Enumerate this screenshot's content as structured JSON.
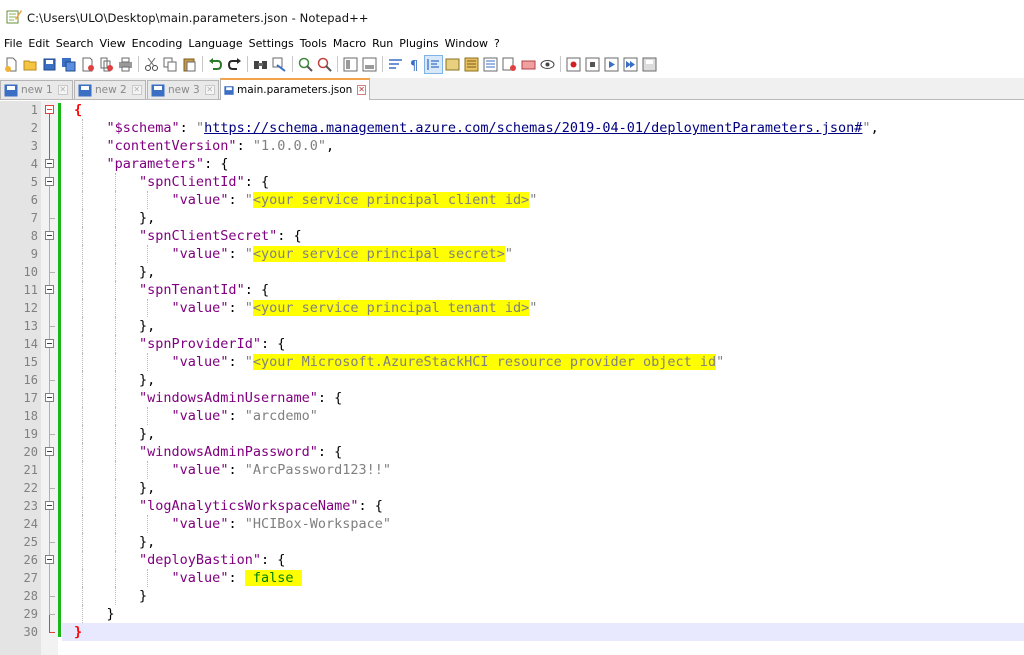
{
  "window": {
    "title": "C:\\Users\\ULO\\Desktop\\main.parameters.json - Notepad++"
  },
  "menu": [
    "File",
    "Edit",
    "Search",
    "View",
    "Encoding",
    "Language",
    "Settings",
    "Tools",
    "Macro",
    "Run",
    "Plugins",
    "Window",
    "?"
  ],
  "toolbar": {
    "icons": [
      "new-file-icon",
      "open-file-icon",
      "save-icon",
      "save-all-icon",
      "close-icon",
      "close-all-icon",
      "print-icon",
      "cut-icon",
      "copy-icon",
      "paste-icon",
      "undo-icon",
      "redo-icon",
      "find-icon",
      "replace-icon",
      "zoom-in-icon",
      "zoom-out-icon",
      "sync-vertical-icon",
      "sync-horizontal-icon",
      "word-wrap-icon",
      "show-all-chars-icon",
      "indent-guide-icon",
      "udl-icon",
      "doc-map-icon",
      "function-list-icon",
      "folder-workspace-icon",
      "monitoring-icon",
      "record-macro-icon",
      "stop-macro-icon",
      "play-macro-icon",
      "run-macro-multiple-icon",
      "save-macro-icon"
    ]
  },
  "tabs": [
    {
      "label": "new 1",
      "active": false
    },
    {
      "label": "new 2",
      "active": false
    },
    {
      "label": "new 3",
      "active": false
    },
    {
      "label": "main.parameters.json",
      "active": true
    }
  ],
  "editor": {
    "current_line": 30,
    "lines": [
      {
        "n": "1",
        "indent": 0,
        "parts": [
          {
            "t": "{",
            "c": "brace-hl"
          }
        ]
      },
      {
        "n": "2",
        "indent": 1,
        "parts": [
          {
            "t": "\"$schema\"",
            "c": "k"
          },
          {
            "t": ": ",
            "c": "p"
          },
          {
            "t": "\"",
            "c": "s"
          },
          {
            "t": "https://schema.management.azure.com/schemas/2019-04-01/deploymentParameters.json#",
            "c": "u"
          },
          {
            "t": "\"",
            "c": "s"
          },
          {
            "t": ",",
            "c": "p"
          }
        ]
      },
      {
        "n": "3",
        "indent": 1,
        "parts": [
          {
            "t": "\"contentVersion\"",
            "c": "k"
          },
          {
            "t": ": ",
            "c": "p"
          },
          {
            "t": "\"1.0.0.0\"",
            "c": "s"
          },
          {
            "t": ",",
            "c": "p"
          }
        ]
      },
      {
        "n": "4",
        "indent": 1,
        "parts": [
          {
            "t": "\"parameters\"",
            "c": "k"
          },
          {
            "t": ": {",
            "c": "p"
          }
        ]
      },
      {
        "n": "5",
        "indent": 2,
        "parts": [
          {
            "t": "\"spnClientId\"",
            "c": "k"
          },
          {
            "t": ": {",
            "c": "p"
          }
        ]
      },
      {
        "n": "6",
        "indent": 3,
        "parts": [
          {
            "t": "\"value\"",
            "c": "k"
          },
          {
            "t": ": ",
            "c": "p"
          },
          {
            "t": "\"",
            "c": "s"
          },
          {
            "t": "<your service principal client id>",
            "c": "s hl"
          },
          {
            "t": "\"",
            "c": "s"
          }
        ]
      },
      {
        "n": "7",
        "indent": 2,
        "parts": [
          {
            "t": "},",
            "c": "p"
          }
        ]
      },
      {
        "n": "8",
        "indent": 2,
        "parts": [
          {
            "t": "\"spnClientSecret\"",
            "c": "k"
          },
          {
            "t": ": {",
            "c": "p"
          }
        ]
      },
      {
        "n": "9",
        "indent": 3,
        "parts": [
          {
            "t": "\"value\"",
            "c": "k"
          },
          {
            "t": ": ",
            "c": "p"
          },
          {
            "t": "\"",
            "c": "s"
          },
          {
            "t": "<your service principal secret>",
            "c": "s hl"
          },
          {
            "t": "\"",
            "c": "s"
          }
        ]
      },
      {
        "n": "10",
        "indent": 2,
        "parts": [
          {
            "t": "},",
            "c": "p"
          }
        ]
      },
      {
        "n": "11",
        "indent": 2,
        "parts": [
          {
            "t": "\"spnTenantId\"",
            "c": "k"
          },
          {
            "t": ": {",
            "c": "p"
          }
        ]
      },
      {
        "n": "12",
        "indent": 3,
        "parts": [
          {
            "t": "\"value\"",
            "c": "k"
          },
          {
            "t": ": ",
            "c": "p"
          },
          {
            "t": "\"",
            "c": "s"
          },
          {
            "t": "<your service principal tenant id>",
            "c": "s hl"
          },
          {
            "t": "\"",
            "c": "s"
          }
        ]
      },
      {
        "n": "13",
        "indent": 2,
        "parts": [
          {
            "t": "},",
            "c": "p"
          }
        ]
      },
      {
        "n": "14",
        "indent": 2,
        "parts": [
          {
            "t": "\"spnProviderId\"",
            "c": "k"
          },
          {
            "t": ": {",
            "c": "p"
          }
        ]
      },
      {
        "n": "15",
        "indent": 3,
        "parts": [
          {
            "t": "\"value\"",
            "c": "k"
          },
          {
            "t": ": ",
            "c": "p"
          },
          {
            "t": "\"",
            "c": "s"
          },
          {
            "t": "<your Microsoft.AzureStackHCI resource provider object id",
            "c": "s hl"
          },
          {
            "t": "\"",
            "c": "s"
          }
        ]
      },
      {
        "n": "16",
        "indent": 2,
        "parts": [
          {
            "t": "},",
            "c": "p"
          }
        ]
      },
      {
        "n": "17",
        "indent": 2,
        "parts": [
          {
            "t": "\"windowsAdminUsername\"",
            "c": "k"
          },
          {
            "t": ": {",
            "c": "p"
          }
        ]
      },
      {
        "n": "18",
        "indent": 3,
        "parts": [
          {
            "t": "\"value\"",
            "c": "k"
          },
          {
            "t": ": ",
            "c": "p"
          },
          {
            "t": "\"arcdemo\"",
            "c": "s"
          }
        ]
      },
      {
        "n": "19",
        "indent": 2,
        "parts": [
          {
            "t": "},",
            "c": "p"
          }
        ]
      },
      {
        "n": "20",
        "indent": 2,
        "parts": [
          {
            "t": "\"windowsAdminPassword\"",
            "c": "k"
          },
          {
            "t": ": {",
            "c": "p"
          }
        ]
      },
      {
        "n": "21",
        "indent": 3,
        "parts": [
          {
            "t": "\"value\"",
            "c": "k"
          },
          {
            "t": ": ",
            "c": "p"
          },
          {
            "t": "\"ArcPassword123!!\"",
            "c": "s"
          }
        ]
      },
      {
        "n": "22",
        "indent": 2,
        "parts": [
          {
            "t": "},",
            "c": "p"
          }
        ]
      },
      {
        "n": "23",
        "indent": 2,
        "parts": [
          {
            "t": "\"logAnalyticsWorkspaceName\"",
            "c": "k"
          },
          {
            "t": ": {",
            "c": "p"
          }
        ]
      },
      {
        "n": "24",
        "indent": 3,
        "parts": [
          {
            "t": "\"value\"",
            "c": "k"
          },
          {
            "t": ": ",
            "c": "p"
          },
          {
            "t": "\"HCIBox-Workspace\"",
            "c": "s"
          }
        ]
      },
      {
        "n": "25",
        "indent": 2,
        "parts": [
          {
            "t": "},",
            "c": "p"
          }
        ]
      },
      {
        "n": "26",
        "indent": 2,
        "parts": [
          {
            "t": "\"deployBastion\"",
            "c": "k"
          },
          {
            "t": ": {",
            "c": "p"
          }
        ]
      },
      {
        "n": "27",
        "indent": 3,
        "parts": [
          {
            "t": "\"value\"",
            "c": "k"
          },
          {
            "t": ": ",
            "c": "p"
          },
          {
            "t": " false ",
            "c": "b hl"
          }
        ]
      },
      {
        "n": "28",
        "indent": 2,
        "parts": [
          {
            "t": "}",
            "c": "p"
          }
        ]
      },
      {
        "n": "29",
        "indent": 1,
        "parts": [
          {
            "t": "}",
            "c": "p"
          }
        ]
      },
      {
        "n": "30",
        "indent": 0,
        "parts": [
          {
            "t": "}",
            "c": "brace-hl"
          }
        ]
      }
    ]
  },
  "colors": {
    "key": "#800080",
    "string": "#808080",
    "highlight": "#ffff00",
    "boolean": "#008000",
    "change_bar": "#18b818",
    "active_tab_accent": "#f3a44a"
  }
}
